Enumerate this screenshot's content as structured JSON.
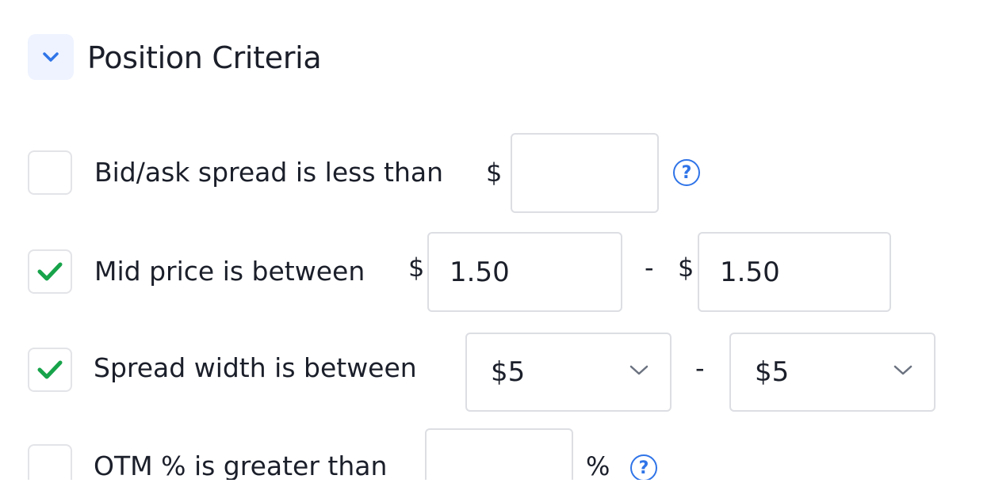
{
  "section": {
    "title": "Position Criteria",
    "collapse_icon": "chevron-down-icon",
    "accent": "#2f74e8"
  },
  "rows": {
    "bid_ask": {
      "checked": false,
      "label": "Bid/ask spread is less than",
      "prefix": "$",
      "value": "",
      "help": "?"
    },
    "mid_price": {
      "checked": true,
      "label": "Mid price is between",
      "prefix_min": "$",
      "min": "1.50",
      "separator": "-",
      "prefix_max": "$",
      "max": "1.50"
    },
    "spread_width": {
      "checked": true,
      "label": "Spread width is between",
      "min": "$5",
      "separator": "-",
      "max": "$5"
    },
    "otm": {
      "checked": false,
      "label": "OTM % is greater than",
      "value": "",
      "suffix": "%",
      "help": "?"
    }
  },
  "colors": {
    "check": "#17a34a",
    "border": "#dcdee3",
    "help": "#2f74e8"
  }
}
